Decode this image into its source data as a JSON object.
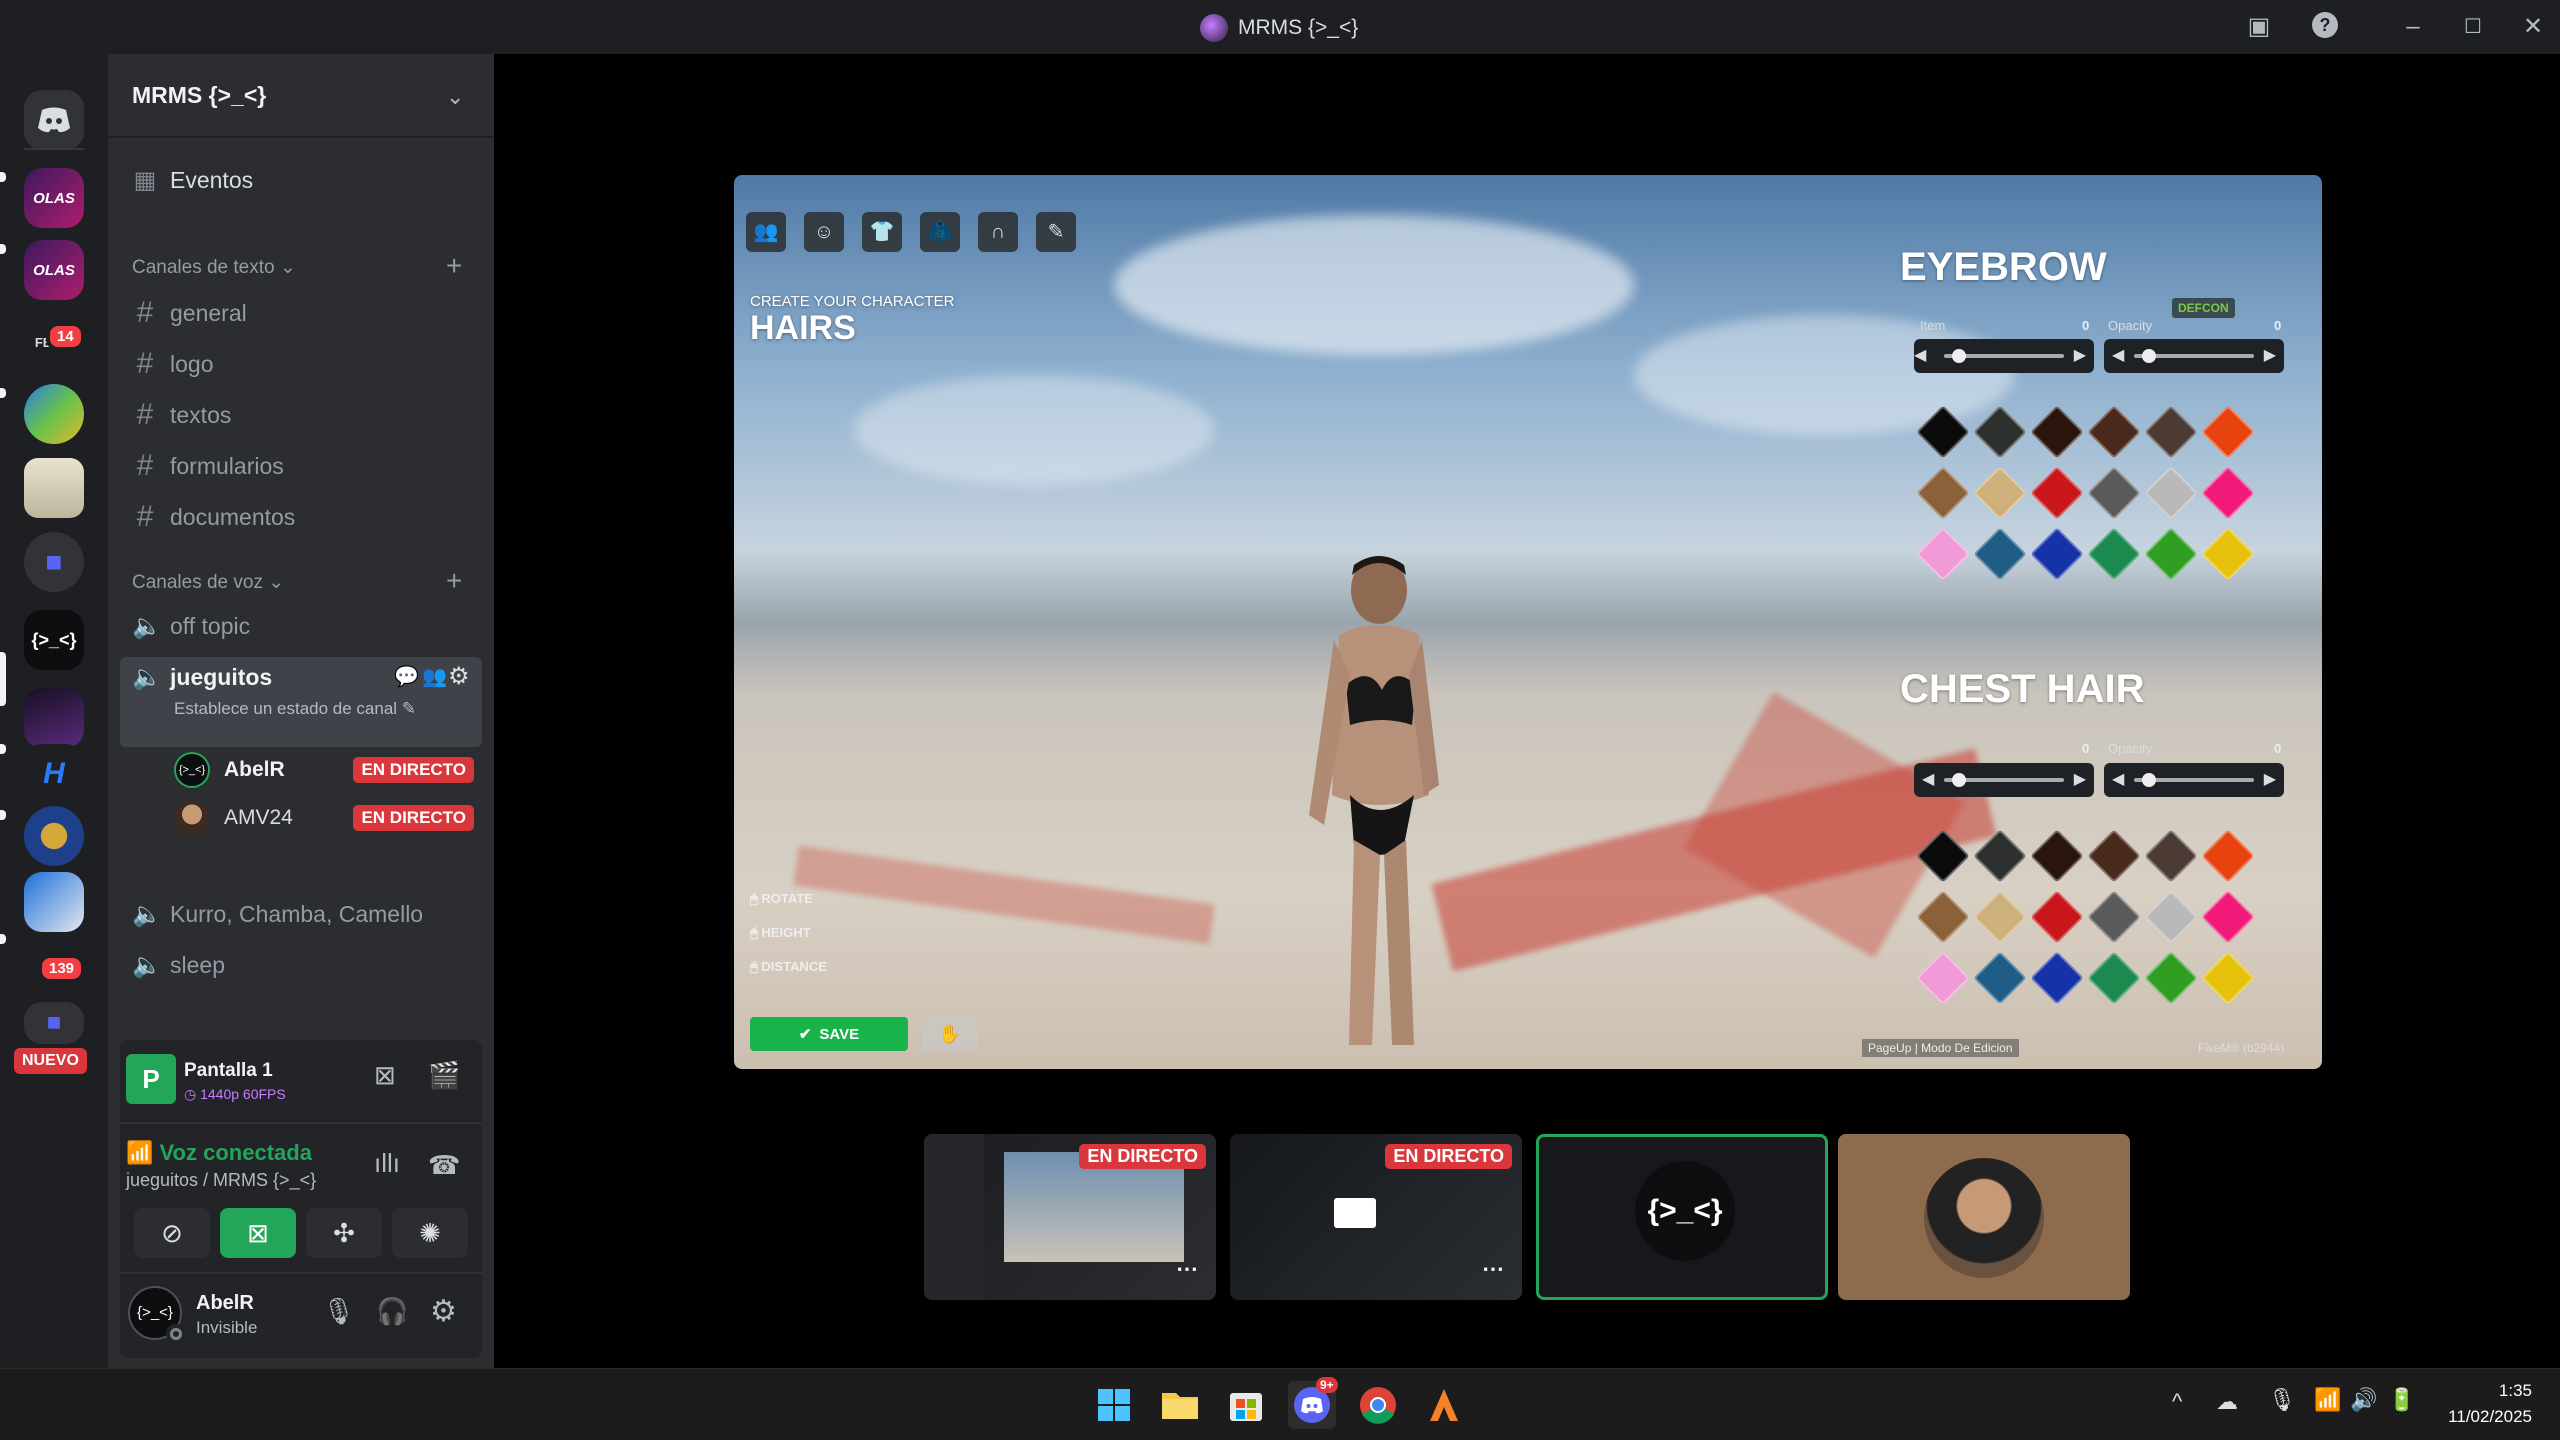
{
  "window": {
    "title": "MRMS {>_<}",
    "controls": [
      "inbox",
      "help",
      "minimize",
      "maximize",
      "close"
    ]
  },
  "server_rail": {
    "badges": {
      "fenix": "14",
      "gaming": "139",
      "new": "NUEVO"
    }
  },
  "sidebar": {
    "server_name": "MRMS {>_<}",
    "events_label": "Eventos",
    "text_category": "Canales de texto",
    "text_channels": [
      "general",
      "logo",
      "textos",
      "formularios",
      "documentos"
    ],
    "voice_category": "Canales de voz",
    "voice_channels": {
      "off_topic": "off topic",
      "jueguitos": "jueguitos",
      "jueguitos_status": "Establece un estado de canal",
      "users": [
        {
          "name": "AbelR",
          "live": "EN DIRECTO"
        },
        {
          "name": "AMV24",
          "live": "EN DIRECTO"
        }
      ],
      "kurro": "Kurro, Chamba, Camello",
      "sleep": "sleep"
    }
  },
  "panel": {
    "stream_title": "Pantalla 1",
    "stream_quality": "1440p 60FPS",
    "voice_status": "Voz conectada",
    "voice_channel": "jueguitos / MRMS {>_<}",
    "user_name": "AbelR",
    "user_status": "Invisible"
  },
  "game": {
    "subtitle": "CREATE YOUR CHARACTER",
    "title": "HAIRS",
    "eyebrow_title": "EYEBROW",
    "chest_title": "CHEST HAIR",
    "item_label": "Item",
    "item_value": "0",
    "opacity_label": "Opacity",
    "opacity_value": "0",
    "controls": [
      "ROTATE",
      "HEIGHT",
      "DISTANCE"
    ],
    "save_label": "SAVE",
    "footer_mode": "PageUp | Modo De Edicion",
    "footer_build": "FiveM® (b2944)",
    "defcon": "DEFCON",
    "colors": [
      "#0b0b0b",
      "#2e302d",
      "#2a150c",
      "#4a2a1c",
      "#4b3b34",
      "#e8420f",
      "#8a6138",
      "#cdb07a",
      "#c8161a",
      "#5a5a5a",
      "#b9b9b9",
      "#f21a78",
      "#f29ad8",
      "#1f5c86",
      "#1532a8",
      "#1d8a4f",
      "#2f9e22",
      "#e6c20d"
    ]
  },
  "thumbnails": [
    {
      "live": "EN DIRECTO"
    },
    {
      "live": "EN DIRECTO"
    },
    {
      "label": "{>_<}"
    },
    {
      "label": ""
    }
  ],
  "taskbar": {
    "time": "1:35",
    "date": "11/02/2025",
    "discord_badge": "9+"
  }
}
